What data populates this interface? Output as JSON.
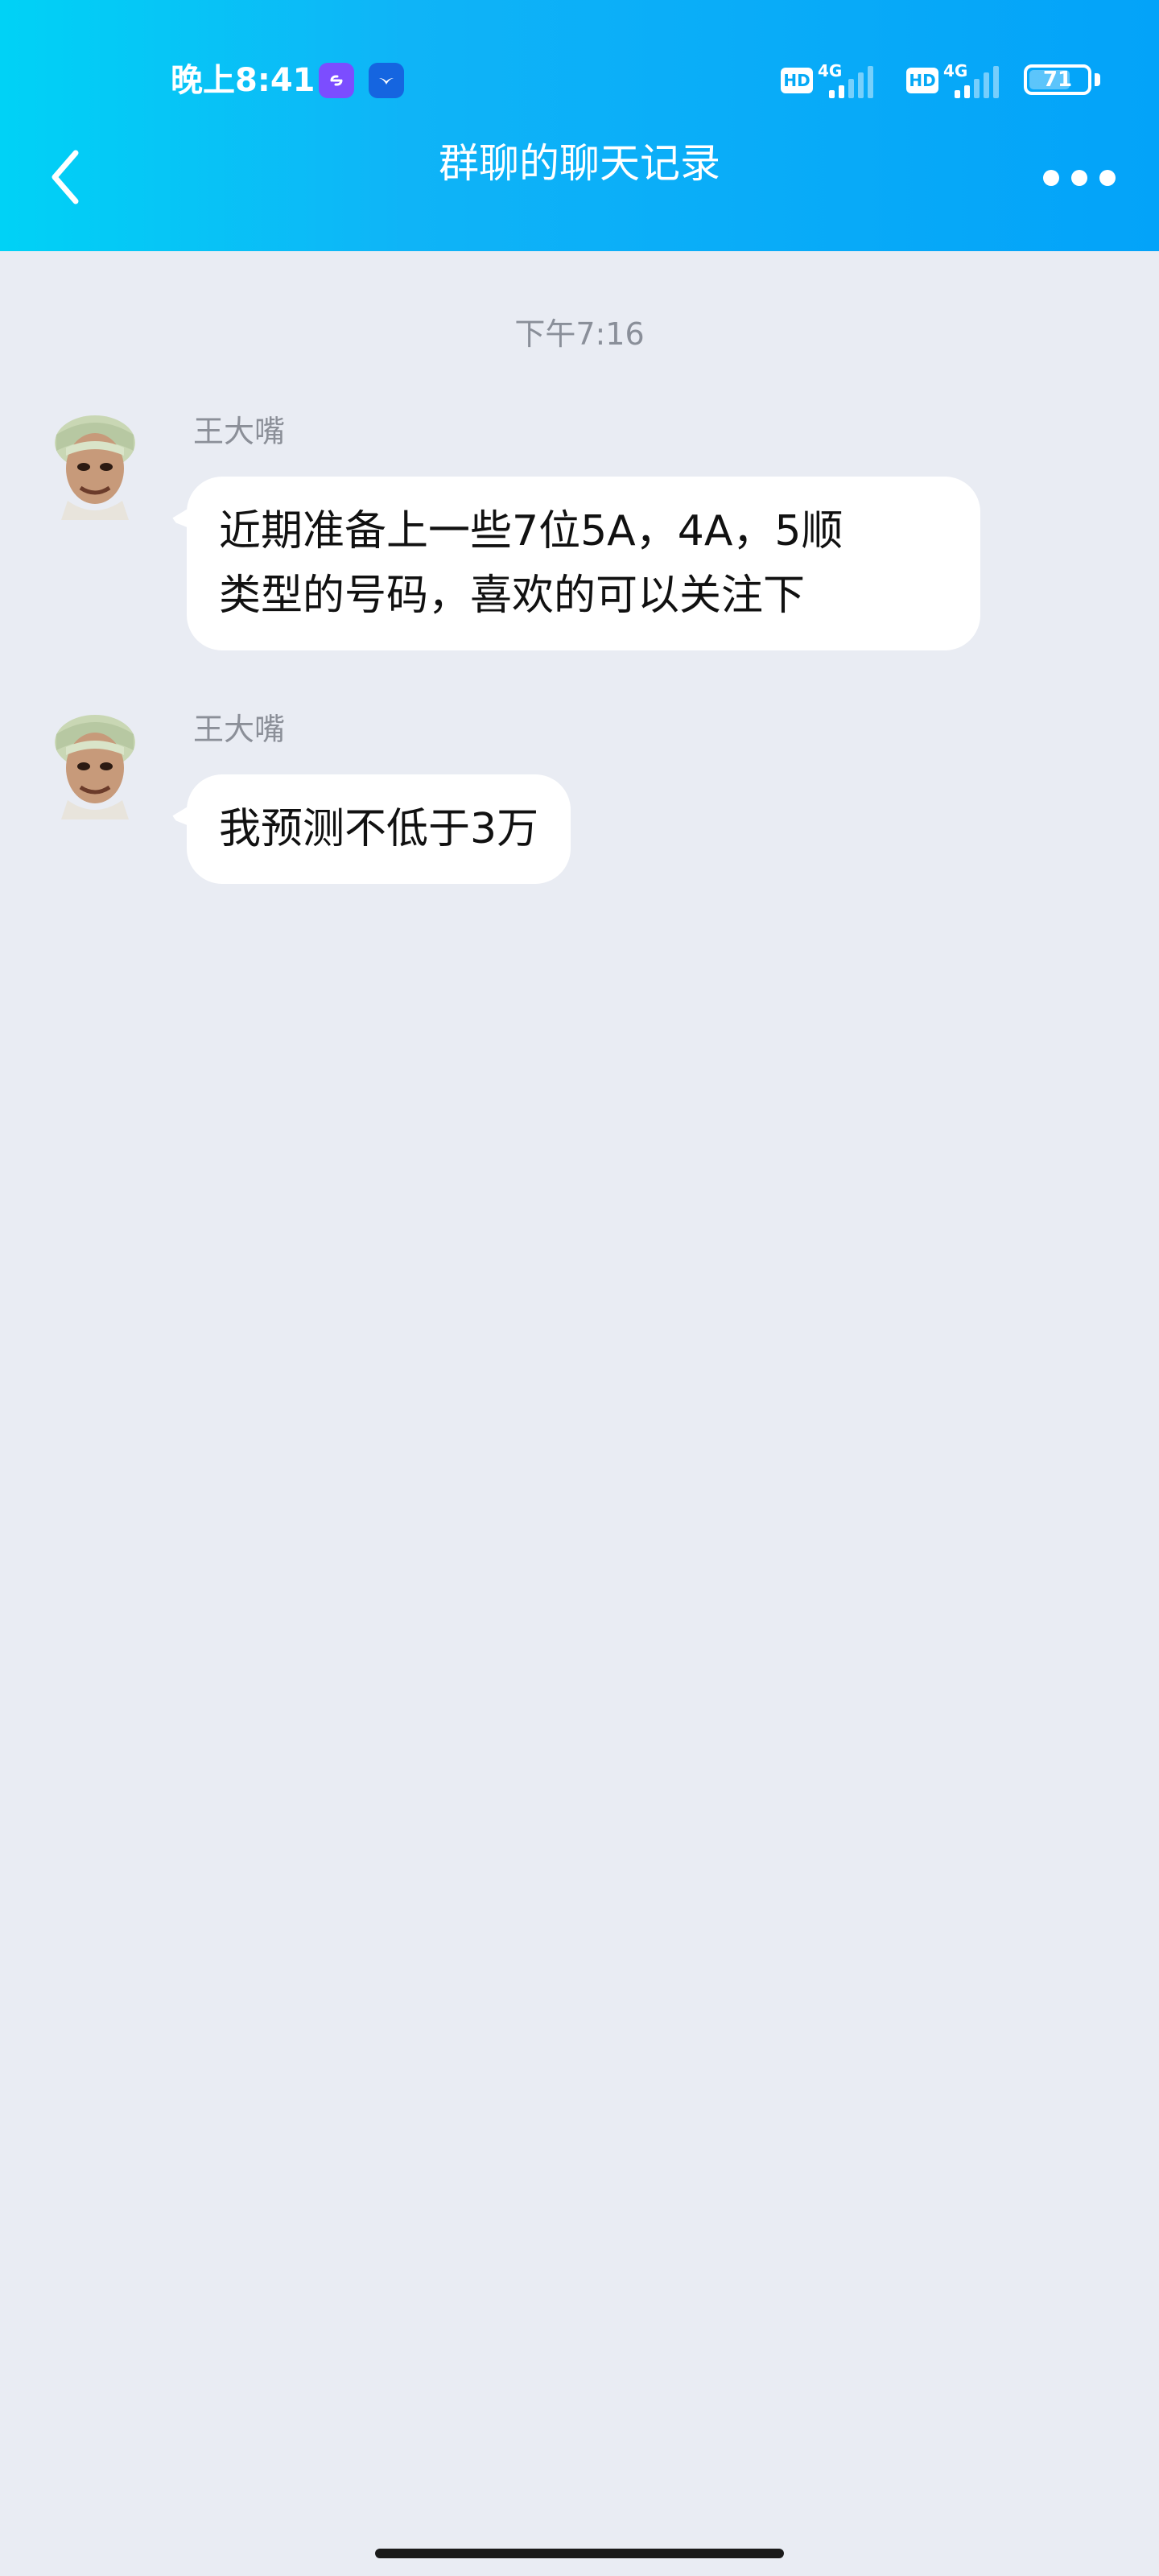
{
  "status_bar": {
    "time": "晚上8:41",
    "sim1": {
      "badge": "HD",
      "network": "4G"
    },
    "sim2": {
      "badge": "HD",
      "network": "4G"
    },
    "battery": "71",
    "battery_level": 0.71
  },
  "header": {
    "title": "群聊的聊天记录"
  },
  "chat": {
    "timestamp": "下午7:16",
    "messages": [
      {
        "sender": "王大嘴",
        "lines": [
          "近期准备上一些7位5A，4A，5顺",
          "类型的号码，喜欢的可以关注下"
        ]
      },
      {
        "sender": "王大嘴",
        "lines": [
          "我预测不低于3万"
        ]
      }
    ]
  },
  "colors": {
    "header_start": "#00d2f6",
    "header_end": "#03a3f9",
    "background": "#e9ecf3",
    "bubble": "#ffffff"
  }
}
